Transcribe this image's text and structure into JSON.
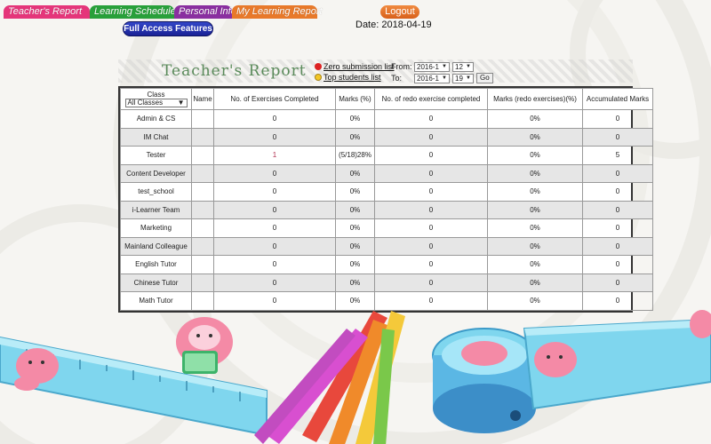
{
  "nav": {
    "tabs": [
      {
        "label": "Teacher's Report",
        "color": "#e5357a"
      },
      {
        "label": "Learning Schedule",
        "color": "#28a03a"
      },
      {
        "label": "Personal Info",
        "color": "#8a2fa0"
      },
      {
        "label": "My Learning Report",
        "color": "#e8792a"
      }
    ],
    "full_access": "Full Access Features"
  },
  "logout_label": "Logout",
  "date_text": "Date: 2018-04-19",
  "report": {
    "title": "Teacher's Report",
    "zero_link": "Zero submission list",
    "top_link": "Top students list",
    "from_label": "From:",
    "to_label": "To:",
    "from_term": "2016-1",
    "from_week": "12",
    "to_term": "2016-1",
    "to_week": "19",
    "go_label": "Go"
  },
  "table": {
    "class_label": "Class",
    "class_filter": "All Classes",
    "headers": [
      "Name",
      "No. of Exercises Completed",
      "Marks (%)",
      "No. of redo exercise completed",
      "Marks (redo exercises)(%)",
      "Accumulated Marks"
    ],
    "rows": [
      {
        "class": "Admin & CS",
        "name": "",
        "completed": "0",
        "marks": "0%",
        "redo": "0",
        "redo_marks": "0%",
        "accum": "0"
      },
      {
        "class": "IM Chat",
        "name": "",
        "completed": "0",
        "marks": "0%",
        "redo": "0",
        "redo_marks": "0%",
        "accum": "0"
      },
      {
        "class": "Tester",
        "name": "",
        "completed": "1",
        "marks": "(5/18)28%",
        "redo": "0",
        "redo_marks": "0%",
        "accum": "5"
      },
      {
        "class": "Content Developer",
        "name": "",
        "completed": "0",
        "marks": "0%",
        "redo": "0",
        "redo_marks": "0%",
        "accum": "0"
      },
      {
        "class": "test_school",
        "name": "",
        "completed": "0",
        "marks": "0%",
        "redo": "0",
        "redo_marks": "0%",
        "accum": "0"
      },
      {
        "class": "i-Learner Team",
        "name": "",
        "completed": "0",
        "marks": "0%",
        "redo": "0",
        "redo_marks": "0%",
        "accum": "0"
      },
      {
        "class": "Marketing",
        "name": "",
        "completed": "0",
        "marks": "0%",
        "redo": "0",
        "redo_marks": "0%",
        "accum": "0"
      },
      {
        "class": "Mainland Colleague",
        "name": "",
        "completed": "0",
        "marks": "0%",
        "redo": "0",
        "redo_marks": "0%",
        "accum": "0"
      },
      {
        "class": "English Tutor",
        "name": "",
        "completed": "0",
        "marks": "0%",
        "redo": "0",
        "redo_marks": "0%",
        "accum": "0"
      },
      {
        "class": "Chinese Tutor",
        "name": "",
        "completed": "0",
        "marks": "0%",
        "redo": "0",
        "redo_marks": "0%",
        "accum": "0"
      },
      {
        "class": "Math Tutor",
        "name": "",
        "completed": "0",
        "marks": "0%",
        "redo": "0",
        "redo_marks": "0%",
        "accum": "0"
      }
    ]
  },
  "icons": {
    "zero_link_icon": "red-dot-icon",
    "top_link_icon": "smiley-icon"
  }
}
